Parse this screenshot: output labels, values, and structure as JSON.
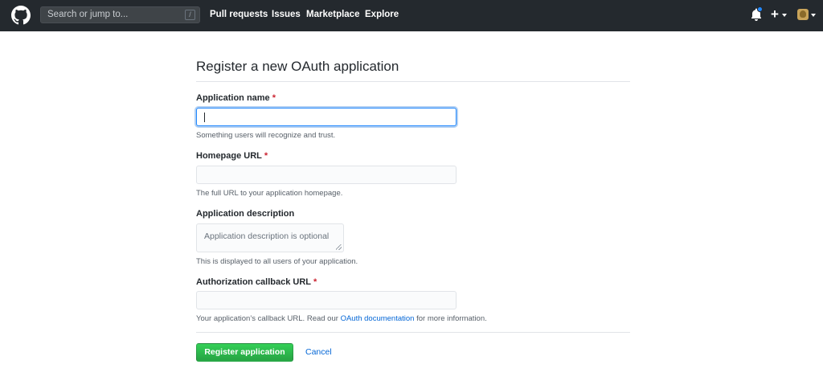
{
  "header": {
    "search_placeholder": "Search or jump to...",
    "search_shortcut": "/",
    "nav": [
      "Pull requests",
      "Issues",
      "Marketplace",
      "Explore"
    ],
    "plus_label": "+",
    "icons": [
      "github-logo-icon",
      "bell-icon",
      "plus-icon",
      "chevron-down-icon",
      "avatar"
    ]
  },
  "page": {
    "title": "Register a new OAuth application",
    "required_marker": "*",
    "fields": {
      "app_name": {
        "label": "Application name",
        "value": "",
        "note": "Something users will recognize and trust."
      },
      "homepage": {
        "label": "Homepage URL",
        "value": "",
        "note": "The full URL to your application homepage."
      },
      "description": {
        "label": "Application description",
        "placeholder": "Application description is optional",
        "note": "This is displayed to all users of your application."
      },
      "callback": {
        "label": "Authorization callback URL",
        "value": "",
        "note_before": "Your application’s callback URL. Read our ",
        "note_link": "OAuth documentation",
        "note_after": " for more information."
      }
    },
    "submit_label": "Register application",
    "cancel_label": "Cancel"
  },
  "colors": {
    "header_bg": "#24292e",
    "primary_green": "#28a745",
    "link_blue": "#0366d6",
    "required_red": "#cb2431",
    "focus_blue": "#2188ff"
  }
}
